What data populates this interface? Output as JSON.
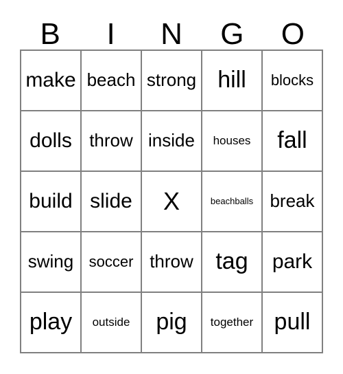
{
  "card": {
    "header": {
      "letters": [
        "B",
        "I",
        "N",
        "G",
        "O"
      ]
    },
    "free_space_marker": "X",
    "colors": {
      "border": "#808080",
      "text": "#000000",
      "background": "#ffffff"
    },
    "rows": [
      [
        {
          "word": "make",
          "size": "lg"
        },
        {
          "word": "beach",
          "size": "md"
        },
        {
          "word": "strong",
          "size": "md"
        },
        {
          "word": "hill",
          "size": "xl"
        },
        {
          "word": "blocks",
          "size": "sm"
        }
      ],
      [
        {
          "word": "dolls",
          "size": "lg"
        },
        {
          "word": "throw",
          "size": "md"
        },
        {
          "word": "inside",
          "size": "md"
        },
        {
          "word": "houses",
          "size": "xs"
        },
        {
          "word": "fall",
          "size": "xl"
        }
      ],
      [
        {
          "word": "build",
          "size": "lg"
        },
        {
          "word": "slide",
          "size": "lg"
        },
        {
          "word": "X",
          "size": "free"
        },
        {
          "word": "beachballs",
          "size": "xxs"
        },
        {
          "word": "break",
          "size": "md"
        }
      ],
      [
        {
          "word": "swing",
          "size": "md"
        },
        {
          "word": "soccer",
          "size": "sm"
        },
        {
          "word": "throw",
          "size": "md"
        },
        {
          "word": "tag",
          "size": "xl"
        },
        {
          "word": "park",
          "size": "lg"
        }
      ],
      [
        {
          "word": "play",
          "size": "xl"
        },
        {
          "word": "outside",
          "size": "xs"
        },
        {
          "word": "pig",
          "size": "xl"
        },
        {
          "word": "together",
          "size": "xs"
        },
        {
          "word": "pull",
          "size": "xl"
        }
      ]
    ]
  }
}
